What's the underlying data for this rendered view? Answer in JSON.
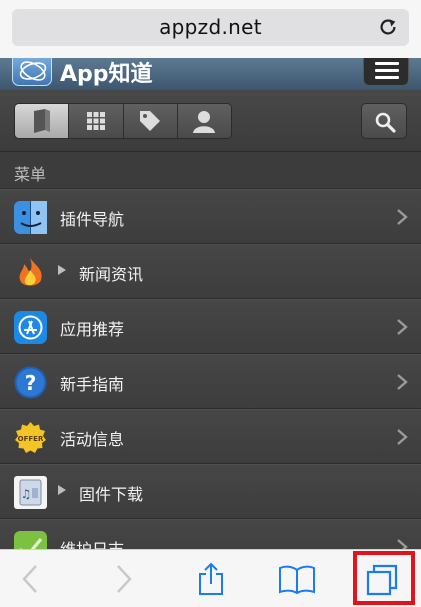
{
  "browser": {
    "url": "appzd.net",
    "icons": {
      "reload": "reload-icon",
      "back": "back-icon",
      "forward": "forward-icon",
      "share": "share-icon",
      "bookmarks": "bookmarks-icon",
      "tabs": "tabs-icon"
    }
  },
  "site": {
    "title": "App知道",
    "icons": {
      "logo": "app-logo-icon",
      "menu": "hamburger-icon"
    }
  },
  "toolbar": {
    "tabs": [
      "book-icon",
      "grid-icon",
      "tag-icon",
      "user-icon"
    ],
    "search_icon": "search-icon"
  },
  "menu": {
    "header": "菜单",
    "items": [
      {
        "label": "插件导航",
        "icon": "finder-icon",
        "expandable": false
      },
      {
        "label": "新闻资讯",
        "icon": "fire-icon",
        "expandable": true
      },
      {
        "label": "应用推荐",
        "icon": "app-store-icon",
        "expandable": false
      },
      {
        "label": "新手指南",
        "icon": "help-icon",
        "expandable": false
      },
      {
        "label": "活动信息",
        "icon": "offer-badge-icon",
        "expandable": false
      },
      {
        "label": "固件下载",
        "icon": "firmware-icon",
        "expandable": true
      },
      {
        "label": "维护日志",
        "icon": "checkmark-icon",
        "expandable": false
      }
    ]
  },
  "colors": {
    "highlight": "#e3131b",
    "ios_blue": "#1a7cf4"
  }
}
